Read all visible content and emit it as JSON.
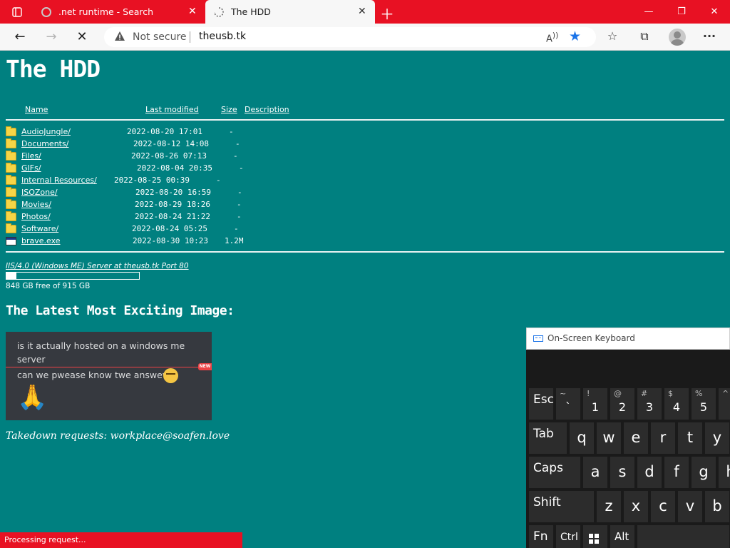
{
  "browser": {
    "tabs": [
      {
        "label": ".net runtime - Search",
        "active": false
      },
      {
        "label": "The HDD",
        "active": true
      }
    ],
    "address": {
      "security": "Not secure",
      "url": "theusb.tk"
    },
    "accent_color": "#e81123"
  },
  "page": {
    "title": "The HDD",
    "columns": {
      "name": "Name",
      "modified": "Last modified",
      "size": "Size",
      "description": "Description"
    },
    "entries": [
      {
        "name": "AudioJungle/",
        "modified": "2022-08-20 17:01",
        "size": "-",
        "type": "folder"
      },
      {
        "name": "Documents/",
        "modified": "2022-08-12 14:08",
        "size": "-",
        "type": "folder"
      },
      {
        "name": "Files/",
        "modified": "2022-08-26 07:13",
        "size": "-",
        "type": "folder"
      },
      {
        "name": "GIFs/",
        "modified": "2022-08-04 20:35",
        "size": "-",
        "type": "folder"
      },
      {
        "name": "Internal Resources/",
        "modified": "2022-08-25 00:39",
        "size": "-",
        "type": "folder"
      },
      {
        "name": "ISOZone/",
        "modified": "2022-08-20 16:59",
        "size": "-",
        "type": "folder"
      },
      {
        "name": "Movies/",
        "modified": "2022-08-29 18:26",
        "size": "-",
        "type": "folder"
      },
      {
        "name": "Photos/",
        "modified": "2022-08-24 21:22",
        "size": "-",
        "type": "folder"
      },
      {
        "name": "Software/",
        "modified": "2022-08-24 05:25",
        "size": "-",
        "type": "folder"
      },
      {
        "name": "brave.exe",
        "modified": "2022-08-30 10:23",
        "size": "1.2M",
        "type": "file"
      }
    ],
    "server_signature": "IIS/4.0 (Windows ME) Server at theusb.tk Port 80",
    "disk": {
      "free_text": "848 GB free of 915 GB",
      "used_fraction": 0.073
    },
    "latest_heading": "The Latest Most Exciting Image:",
    "chat": {
      "message1": "is it actually hosted on a windows me server",
      "new_badge": "NEW",
      "message2": "can we pwease know twe answew"
    },
    "takedown": "Takedown requests: workplace@soafen.love",
    "background_color": "#008080"
  },
  "status": {
    "text": "Processing request..."
  },
  "keyboard": {
    "title": "On-Screen Keyboard",
    "rows": [
      [
        {
          "label": "Esc"
        },
        {
          "top": "~",
          "bottom": "`"
        },
        {
          "top": "!",
          "bottom": "1"
        },
        {
          "top": "@",
          "bottom": "2"
        },
        {
          "top": "#",
          "bottom": "3"
        },
        {
          "top": "$",
          "bottom": "4"
        },
        {
          "top": "%",
          "bottom": "5"
        },
        {
          "top": "^",
          "bottom": ""
        }
      ],
      [
        {
          "label": "Tab"
        },
        {
          "char": "q"
        },
        {
          "char": "w"
        },
        {
          "char": "e"
        },
        {
          "char": "r"
        },
        {
          "char": "t"
        },
        {
          "char": "y"
        }
      ],
      [
        {
          "label": "Caps"
        },
        {
          "char": "a"
        },
        {
          "char": "s"
        },
        {
          "char": "d"
        },
        {
          "char": "f"
        },
        {
          "char": "g"
        },
        {
          "char": "h"
        }
      ],
      [
        {
          "label": "Shift"
        },
        {
          "char": "z"
        },
        {
          "char": "x"
        },
        {
          "char": "c"
        },
        {
          "char": "v"
        },
        {
          "char": "b"
        }
      ],
      [
        {
          "label": "Fn"
        },
        {
          "label": "Ctrl"
        },
        {
          "icon": "windows-icon"
        },
        {
          "label": "Alt"
        }
      ]
    ]
  }
}
